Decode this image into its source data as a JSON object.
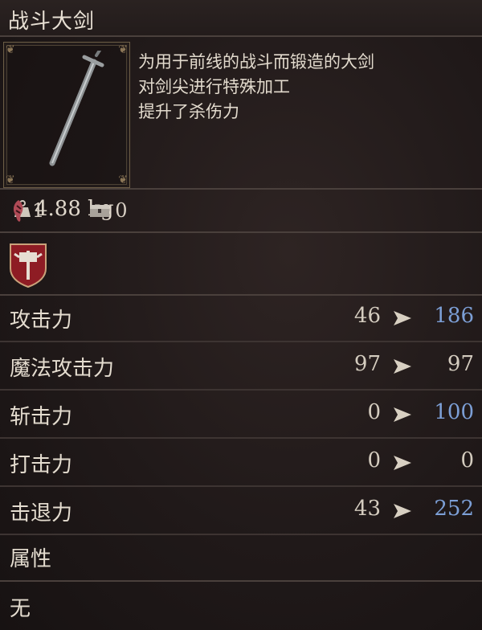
{
  "item": {
    "name": "战斗大剑",
    "weight": "4.88 kg",
    "description": [
      "为用于前线的战斗而锻造的大剑",
      "对剑尖进行特殊加工",
      "提升了杀伤力"
    ]
  },
  "requirements": {
    "strength": "1",
    "slots": "0"
  },
  "stats": [
    {
      "label": "攻击力",
      "base": "46",
      "new": "186",
      "new_color": "#7c9fd6"
    },
    {
      "label": "魔法攻击力",
      "base": "97",
      "new": "97",
      "new_color": "#d4ccbf"
    },
    {
      "label": "斩击力",
      "base": "0",
      "new": "100",
      "new_color": "#7c9fd6"
    },
    {
      "label": "打击力",
      "base": "0",
      "new": "0",
      "new_color": "#d4ccbf"
    },
    {
      "label": "击退力",
      "base": "43",
      "new": "252",
      "new_color": "#7c9fd6"
    }
  ],
  "attribute": {
    "label": "属性",
    "value": "无"
  },
  "colors": {
    "upgrade": "#7c9fd6",
    "neutral": "#d4ccbf",
    "shield": "#8e1c24"
  },
  "icons": [
    "weight-icon",
    "strength-requirement-icon",
    "slot-chest-icon",
    "class-shield-icon",
    "stat-arrow-icon"
  ]
}
